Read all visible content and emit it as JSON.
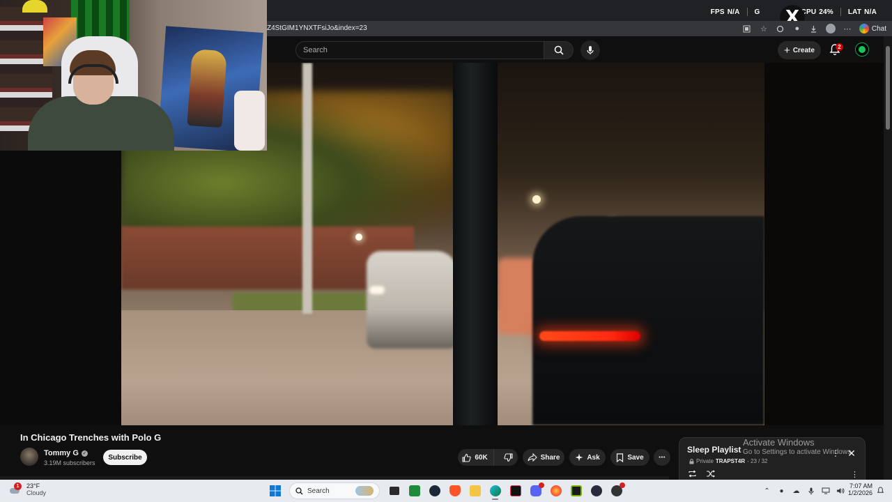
{
  "overlay": {
    "stats": [
      {
        "label": "FPS",
        "value": "N/A"
      },
      {
        "label": "G",
        "value": ""
      },
      {
        "label": "CPU",
        "value": "24%"
      },
      {
        "label": "LAT",
        "value": "N/A"
      }
    ],
    "x_logo": "X"
  },
  "browser": {
    "url": "Z4StGIM1YNXTFsiJo&index=23",
    "chat_label": "Chat"
  },
  "youtube_header": {
    "search_placeholder": "Search",
    "create_label": "Create",
    "notification_count": "2"
  },
  "video": {
    "title": "In Chicago Trenches with Polo G",
    "channel_name": "Tommy G",
    "subscribers": "3.19M subscribers",
    "subscribe_label": "Subscribe",
    "like_count": "60K",
    "share_label": "Share",
    "ask_label": "Ask",
    "save_label": "Save"
  },
  "playlist": {
    "title": "Sleep Playlist",
    "privacy": "Private",
    "owner": "TRAPST4R",
    "position": "- 23 / 32"
  },
  "windows_watermark": {
    "line1": "Activate Windows",
    "line2": "Go to Settings to activate Windows."
  },
  "taskbar": {
    "weather_temp": "23°F",
    "weather_condition": "Cloudy",
    "weather_badge": "1",
    "search_label": "Search",
    "time": "7:07 AM",
    "date": "1/2/2026"
  },
  "colors": {
    "youtube_bg": "#0f0f0f",
    "pill_bg": "#272727",
    "notification_red": "#cc0000",
    "taskbar_bg": "#e7ebf0"
  }
}
